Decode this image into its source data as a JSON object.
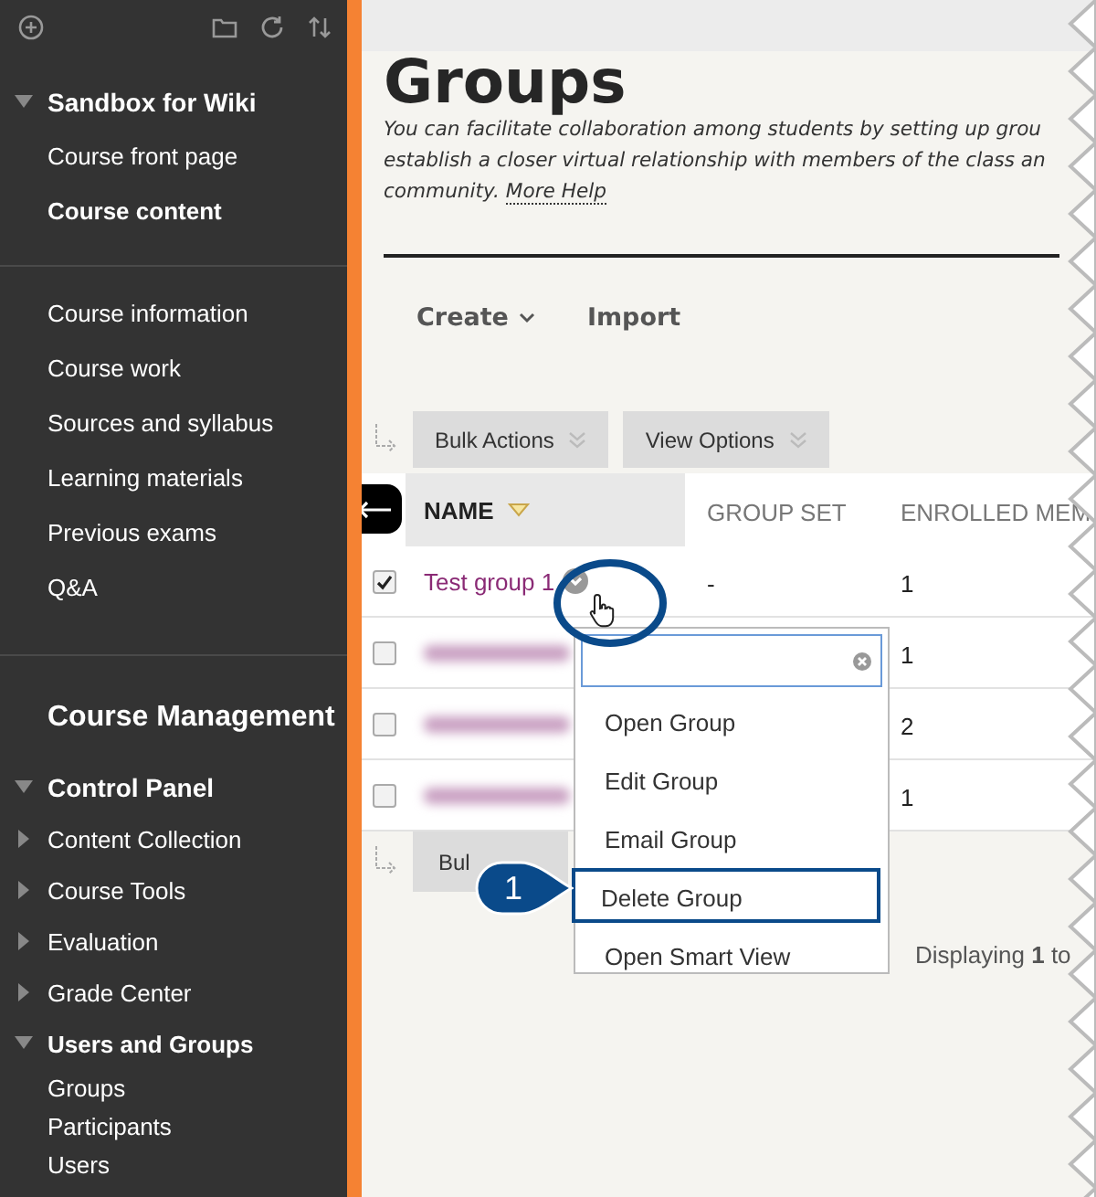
{
  "sidebar": {
    "course": {
      "title": "Sandbox for Wiki",
      "expanded": true,
      "items": [
        {
          "label": "Course front page",
          "selected": false
        },
        {
          "label": "Course content",
          "selected": true
        }
      ]
    },
    "links": [
      "Course information",
      "Course work",
      "Sources and syllabus",
      "Learning materials",
      "Previous exams",
      "Q&A"
    ],
    "management": {
      "title": "Course Management",
      "control_panel": {
        "title": "Control Panel",
        "expanded": true,
        "sections": [
          {
            "label": "Content Collection",
            "expanded": false
          },
          {
            "label": "Course Tools",
            "expanded": false
          },
          {
            "label": "Evaluation",
            "expanded": false
          },
          {
            "label": "Grade Center",
            "expanded": false
          },
          {
            "label": "Users and Groups",
            "expanded": true,
            "children": [
              {
                "label": "Groups"
              },
              {
                "label": "Participants"
              },
              {
                "label": "Users"
              }
            ]
          }
        ]
      }
    }
  },
  "page": {
    "title": "Groups",
    "description_lines": [
      "You can facilitate collaboration among students by setting up grou",
      "establish a closer virtual relationship with members of the class an",
      "community."
    ],
    "help_link": "More Help",
    "actions": [
      {
        "label": "Create",
        "dropdown": true
      },
      {
        "label": "Import",
        "dropdown": false
      }
    ],
    "table": {
      "top_buttons": [
        "Bulk Actions",
        "View Options"
      ],
      "columns": [
        {
          "label": "NAME",
          "sorted": true
        },
        {
          "label": "GROUP SET",
          "sorted": false
        },
        {
          "label": "ENROLLED MEM",
          "sorted": false
        }
      ],
      "rows": [
        {
          "name": "Test group 1",
          "blurred": false,
          "checked": true,
          "group_set": "-",
          "enrolled": "1"
        },
        {
          "blurred": true,
          "checked": false,
          "enrolled": "1"
        },
        {
          "blurred": true,
          "checked": false,
          "enrolled": "2"
        },
        {
          "blurred": true,
          "checked": false,
          "enrolled": "1"
        }
      ],
      "bottom_button": "Bul",
      "footer": "Displaying **1** to"
    },
    "menu": {
      "items": [
        {
          "label": "Open Group",
          "selected": false
        },
        {
          "label": "Edit Group",
          "selected": false
        },
        {
          "label": "Email Group",
          "selected": false
        },
        {
          "label": "Delete Group",
          "selected": true
        },
        {
          "label": "Open Smart View",
          "selected": false
        }
      ]
    },
    "callout": "1"
  }
}
